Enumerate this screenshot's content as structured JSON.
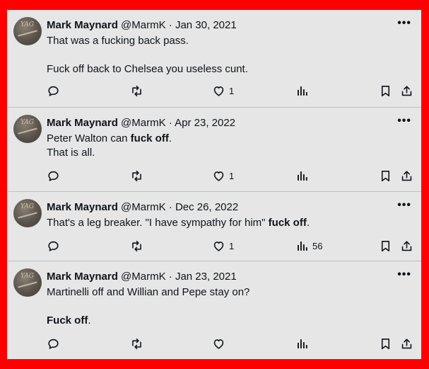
{
  "tweets": [
    {
      "name": "Mark Maynard",
      "handle": "@MarmK",
      "separator": "·",
      "date": "Jan 30, 2021",
      "text": "That was a fucking back pass.\n\nFuck off back to Chelsea you useless cunt.",
      "likes": "1",
      "views": "",
      "more": "•••"
    },
    {
      "name": "Mark Maynard",
      "handle": "@MarmK",
      "separator": "·",
      "date": "Apr 23, 2022",
      "text_parts": [
        "Peter Walton can ",
        "fuck off",
        ".\nThat is all."
      ],
      "likes": "1",
      "views": "",
      "more": "•••"
    },
    {
      "name": "Mark Maynard",
      "handle": "@MarmK",
      "separator": "·",
      "date": "Dec 26, 2022",
      "text_parts": [
        "That's a leg breaker. \"I have sympathy for him\" ",
        "fuck off",
        "."
      ],
      "likes": "1",
      "views": "56",
      "more": "•••"
    },
    {
      "name": "Mark Maynard",
      "handle": "@MarmK",
      "separator": "·",
      "date": "Jan 23, 2021",
      "text_parts": [
        "Martinelli off and Willian and Pepe stay on?\n\n",
        "Fuck off",
        "."
      ],
      "likes": "",
      "views": "",
      "more": "•••"
    }
  ],
  "icons": {
    "reply": "reply-icon",
    "retweet": "retweet-icon",
    "like": "like-icon",
    "views": "views-icon",
    "bookmark": "bookmark-icon",
    "share": "share-icon"
  },
  "colors": {
    "frame": "#ff0000",
    "card": "#e6e6e6",
    "divider": "#b8c2cb",
    "text": "#0f1419"
  }
}
